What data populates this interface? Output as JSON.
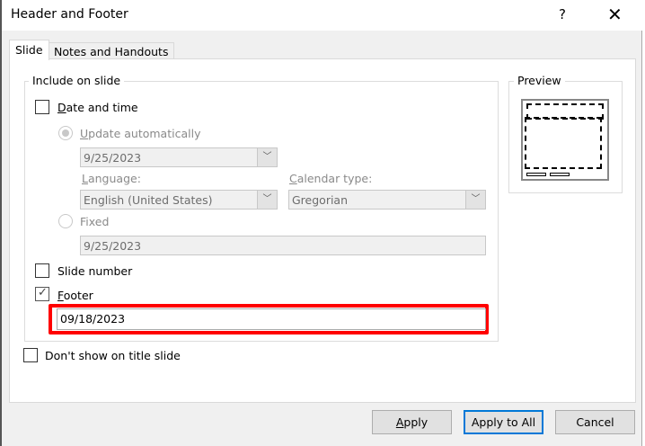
{
  "dialog": {
    "title": "Header and Footer",
    "help": "?",
    "close": "✕"
  },
  "tabs": [
    {
      "label": "Slide"
    },
    {
      "label": "Notes and Handouts"
    }
  ],
  "include": {
    "legend": "Include on slide",
    "date_time": {
      "label": "Date and time",
      "checked": false
    },
    "update_auto": {
      "label": "Update automatically",
      "value": "9/25/2023"
    },
    "language": {
      "label": "Language:",
      "value": "English (United States)"
    },
    "calendar": {
      "label": "Calendar type:",
      "value": "Gregorian"
    },
    "fixed": {
      "label": "Fixed",
      "value": "9/25/2023"
    },
    "slide_number": {
      "label": "Slide number",
      "checked": false
    },
    "footer": {
      "label": "Footer",
      "checked": true,
      "value": "09/18/2023"
    }
  },
  "dont_show": {
    "label": "Don't show on title slide",
    "checked": false
  },
  "preview": {
    "legend": "Preview"
  },
  "buttons": {
    "apply": "Apply",
    "apply_all": "Apply to All",
    "cancel": "Cancel"
  },
  "colors": {
    "highlight": "#ff0000",
    "focus": "#0078d7"
  }
}
